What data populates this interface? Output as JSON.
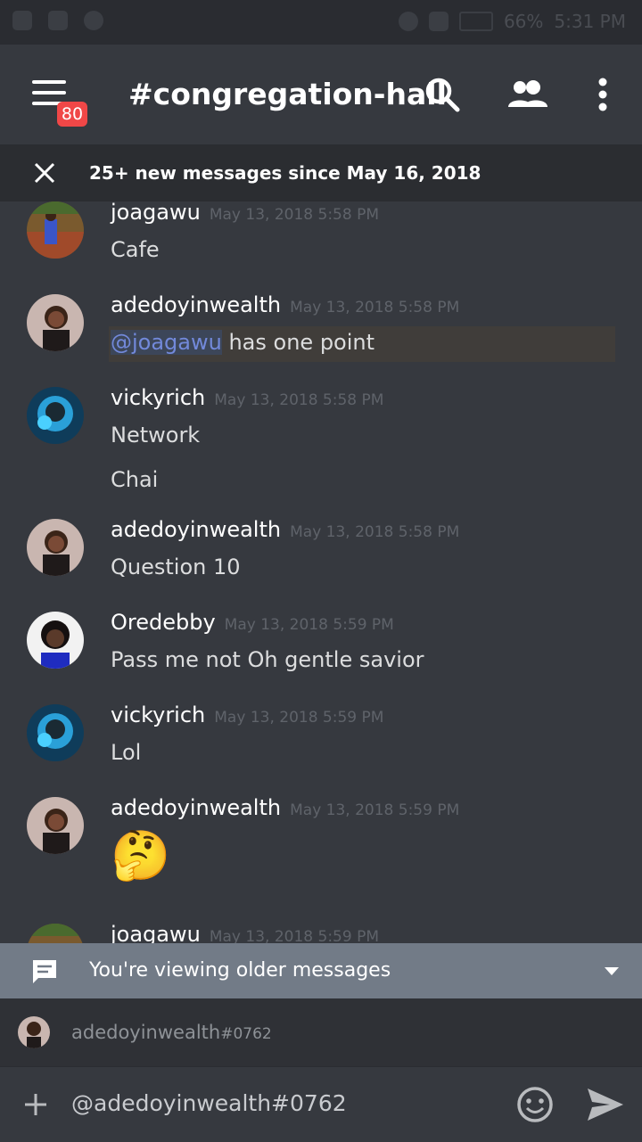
{
  "status_bar": {
    "battery": "66%",
    "time": "5:31 PM"
  },
  "header": {
    "channel_name": "#congregation-hall",
    "menu_badge": "80"
  },
  "banner": {
    "text": "25+ new messages since May 16, 2018"
  },
  "messages": [
    {
      "author": "joagawu",
      "timestamp": "May 13, 2018 5:58 PM",
      "lines": [
        "Cafe"
      ]
    },
    {
      "author": "adedoyinwealth",
      "timestamp": "May 13, 2018 5:58 PM",
      "mention": "@joagawu",
      "text": " has one point"
    },
    {
      "author": "vickyrich",
      "timestamp": "May 13, 2018 5:58 PM",
      "lines": [
        "Network",
        "Chai"
      ]
    },
    {
      "author": "adedoyinwealth",
      "timestamp": "May 13, 2018 5:58 PM",
      "lines": [
        "Question 10"
      ]
    },
    {
      "author": "Oredebby",
      "timestamp": "May 13, 2018 5:59 PM",
      "lines": [
        "Pass me not Oh gentle savior"
      ]
    },
    {
      "author": "vickyrich",
      "timestamp": "May 13, 2018 5:59 PM",
      "lines": [
        "Lol"
      ]
    },
    {
      "author": "adedoyinwealth",
      "timestamp": "May 13, 2018 5:59 PM",
      "emoji": "🤔"
    },
    {
      "author": "joagawu",
      "timestamp": "May 13, 2018 5:59 PM"
    }
  ],
  "older_bar": {
    "text": "You're viewing older messages"
  },
  "reply_suggestion": {
    "name": "adedoyinwealth",
    "tag": "#0762"
  },
  "composer": {
    "value": "@adedoyinwealth#0762"
  },
  "colors": {
    "background": "#36393f",
    "mention": "#7289da",
    "badge": "#f04747",
    "older_bar": "#727b87"
  }
}
